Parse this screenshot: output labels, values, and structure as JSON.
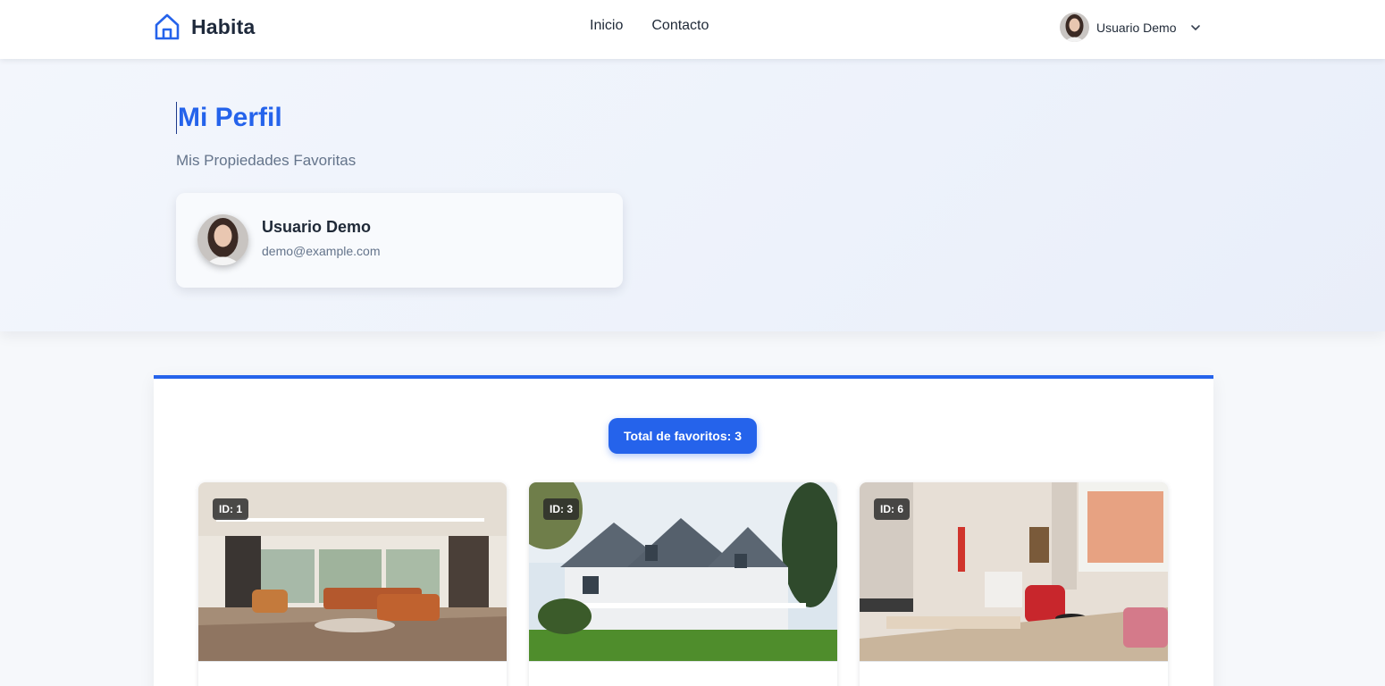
{
  "navbar": {
    "brand": "Habita",
    "links": [
      "Inicio",
      "Contacto"
    ],
    "user_name": "Usuario Demo"
  },
  "hero": {
    "title": "Mi Perfil",
    "subtitle": "Mis Propiedades Favoritas"
  },
  "profile": {
    "name": "Usuario Demo",
    "email": "demo@example.com"
  },
  "favorites": {
    "total_label": "Total de favoritos: 3",
    "cards": [
      {
        "id_label": "ID: 1",
        "image": "modern living room interior"
      },
      {
        "id_label": "ID: 3",
        "image": "white two-story house with porch"
      },
      {
        "id_label": "ID: 6",
        "image": "apartment interior with red armchair"
      }
    ]
  },
  "colors": {
    "accent": "#2563eb",
    "text_dark": "#1f2937",
    "text_muted": "#64748b"
  }
}
